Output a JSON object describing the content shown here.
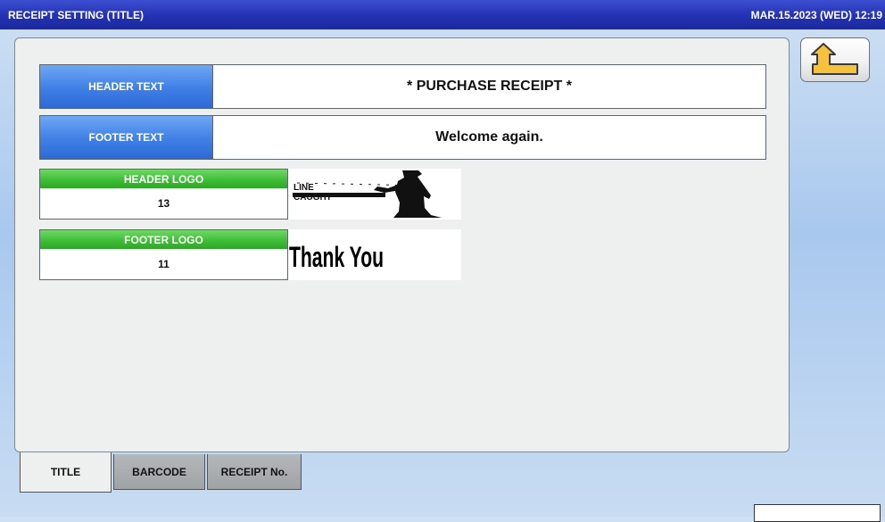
{
  "titlebar": {
    "title": "RECEIPT SETTING (TITLE)",
    "clock": "MAR.15.2023 (WED)  12:19"
  },
  "settings": {
    "header_text": {
      "label": "HEADER TEXT",
      "value": "* PURCHASE RECEIPT *"
    },
    "footer_text": {
      "label": "FOOTER TEXT",
      "value": "Welcome again."
    },
    "header_logo": {
      "label": "HEADER LOGO",
      "value": "13",
      "image_text": "LINE CAUGHT"
    },
    "footer_logo": {
      "label": "FOOTER LOGO",
      "value": "11",
      "image_text": "Thank You"
    }
  },
  "tabs": [
    {
      "label": "TITLE",
      "active": true
    },
    {
      "label": "BARCODE",
      "active": false
    },
    {
      "label": "RECEIPT No.",
      "active": false
    }
  ],
  "icons": {
    "back": "return-arrow-icon"
  },
  "colors": {
    "titlebar": "#2331b3",
    "text_label": "#3f7fe6",
    "logo_label": "#3cbc34",
    "back_arrow": "#f6c23b"
  }
}
